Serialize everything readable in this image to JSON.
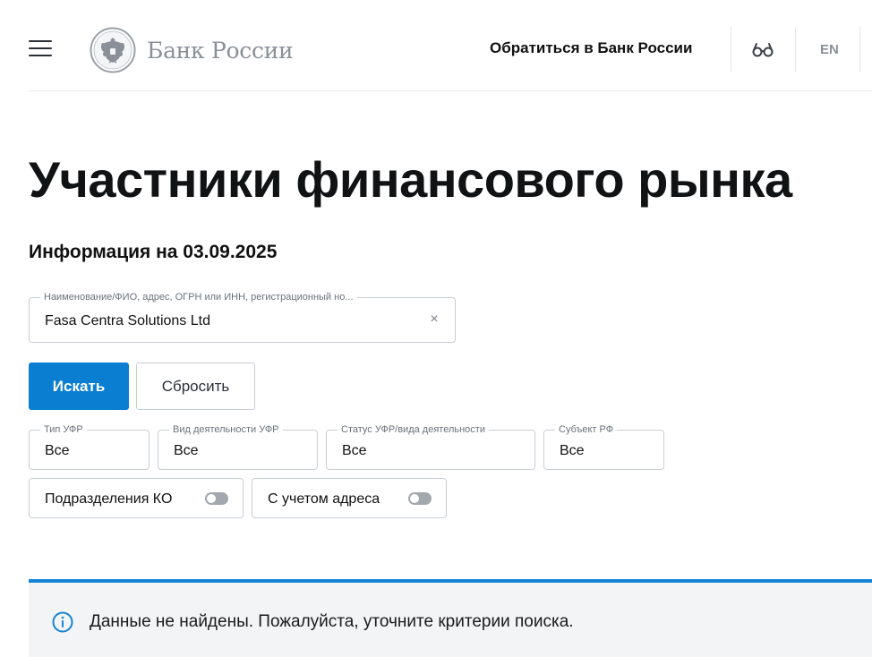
{
  "header": {
    "logo_text": "Банк России",
    "contact_link": "Обратиться в Банк России",
    "lang": "EN"
  },
  "page": {
    "title": "Участники финансового рынка",
    "info_date": "Информация на 03.09.2025"
  },
  "search": {
    "label": "Наименование/ФИО, адрес, ОГРН или ИНН, регистрационный но...",
    "value": "Fasa Centra Solutions Ltd",
    "clear_glyph": "×"
  },
  "buttons": {
    "search": "Искать",
    "reset": "Сбросить"
  },
  "filters": [
    {
      "label": "Тип УФР",
      "value": "Все"
    },
    {
      "label": "Вид деятельности УФР",
      "value": "Все"
    },
    {
      "label": "Статус УФР/вида деятельности",
      "value": "Все"
    },
    {
      "label": "Субъект РФ",
      "value": "Все"
    }
  ],
  "toggles": [
    {
      "label": "Подразделения КО",
      "on": false
    },
    {
      "label": "С учетом адреса",
      "on": false
    }
  ],
  "alert": {
    "text": "Данные не найдены. Пожалуйста, уточните критерии поиска."
  },
  "colors": {
    "primary": "#0a7ed1",
    "alert_border": "#1584d2",
    "alert_bg": "#f2f4f6",
    "muted": "#8b9098"
  },
  "icons": {
    "menu": "hamburger-menu-icon",
    "logo": "double-headed-eagle-emblem-icon",
    "accessibility": "glasses-icon",
    "clear": "close-icon",
    "alert": "info-circle-icon"
  }
}
